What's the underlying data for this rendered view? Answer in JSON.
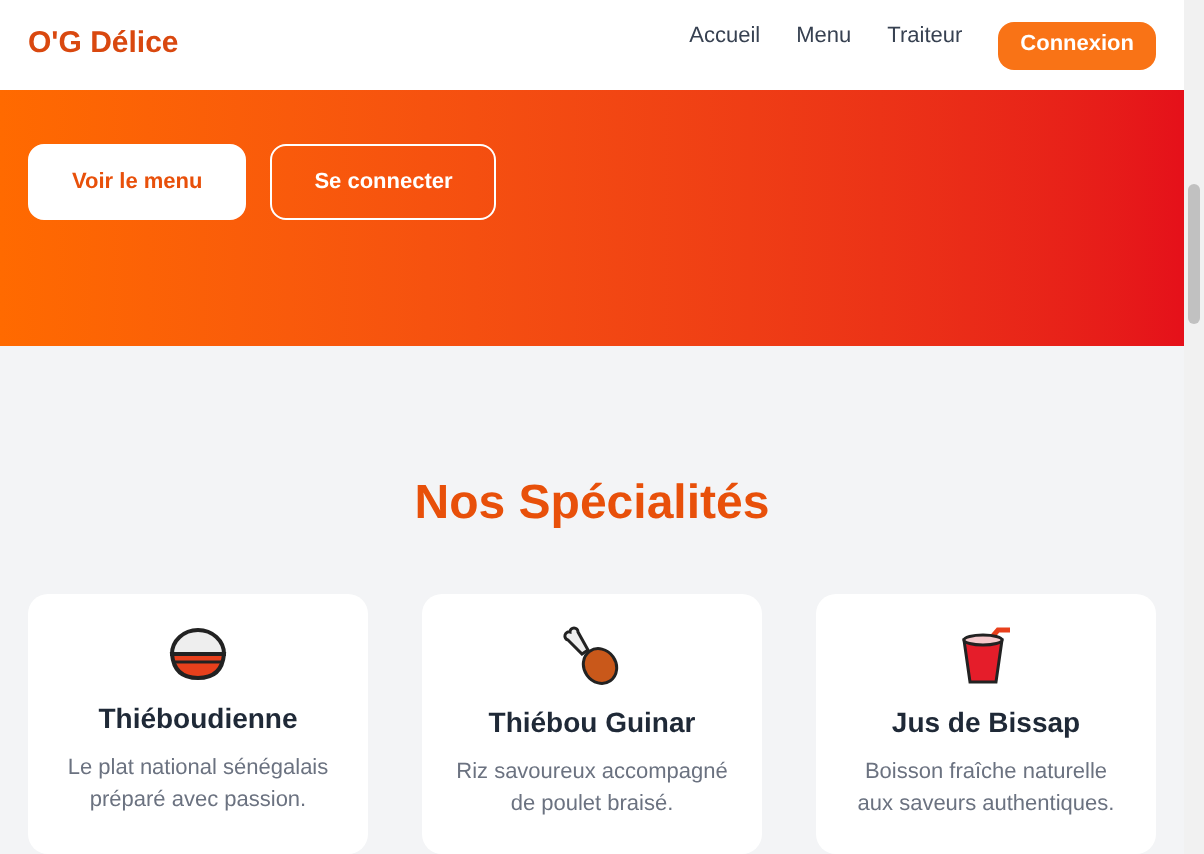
{
  "header": {
    "logo": "O'G Délice",
    "nav": [
      "Accueil",
      "Menu",
      "Traiteur"
    ],
    "login_button": "Connexion"
  },
  "hero": {
    "buttons": [
      {
        "label": "Voir le menu",
        "kind": "primary"
      },
      {
        "label": "Se connecter",
        "kind": "outline"
      }
    ]
  },
  "specialties": {
    "title": "Nos Spécialités",
    "cards": [
      {
        "title": "Thiéboudienne",
        "description": "Le plat national sénégalais préparé avec passion."
      },
      {
        "title": "Thiébou Guinar",
        "description": "Riz savoureux accompagné de poulet braisé."
      },
      {
        "title": "Jus de Bissap",
        "description": "Boisson fraîche naturelle aux saveurs authentiques."
      }
    ]
  }
}
